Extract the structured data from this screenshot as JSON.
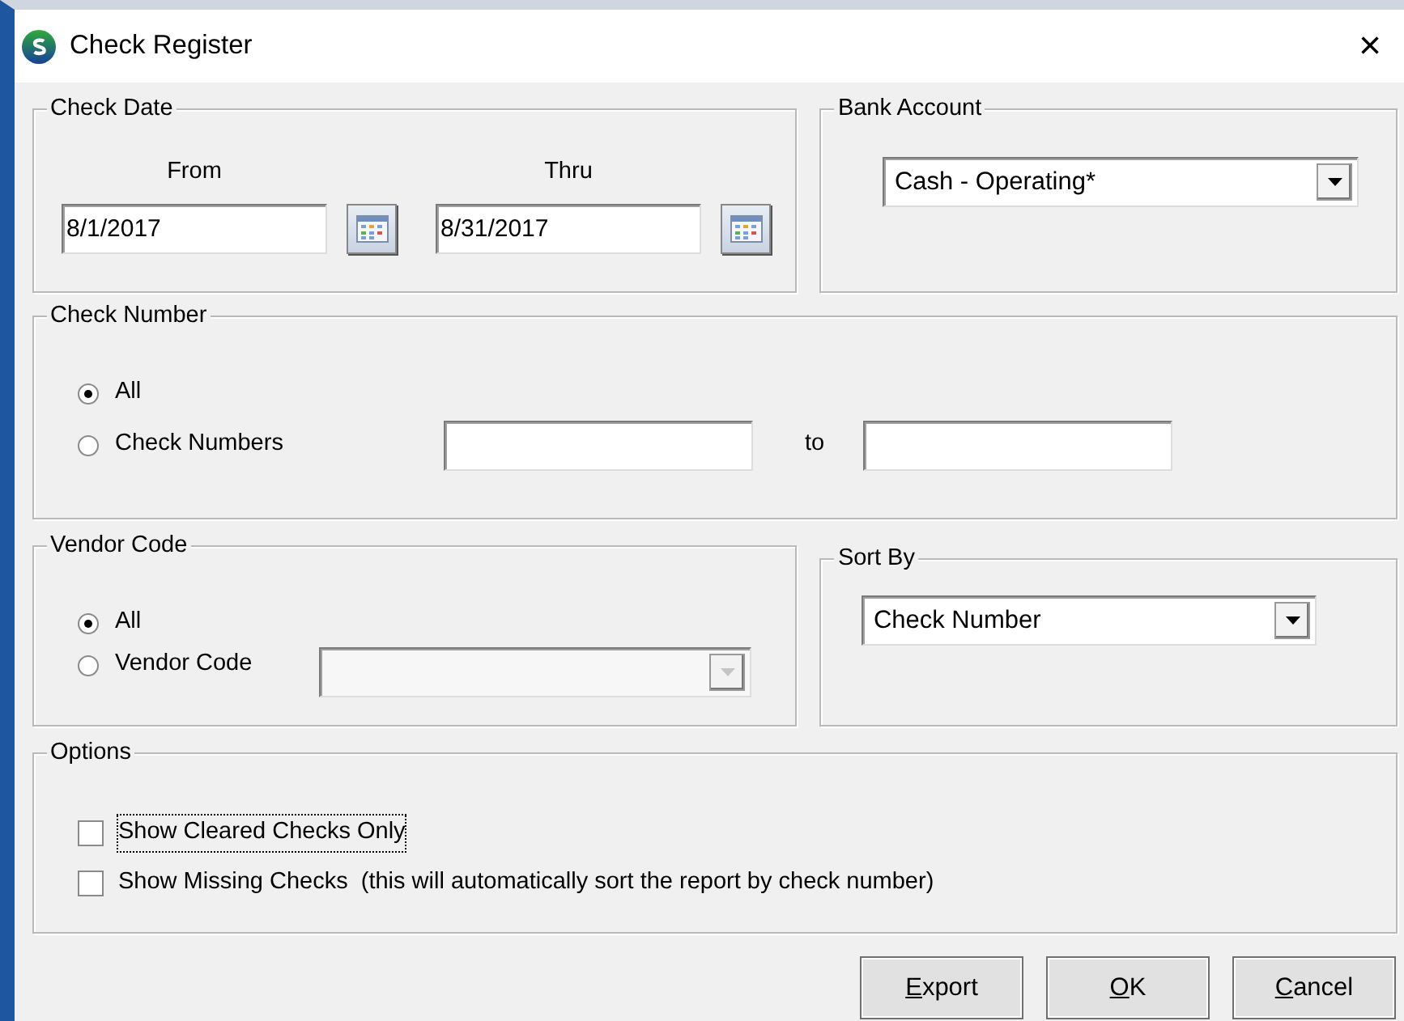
{
  "window": {
    "title": "Check Register",
    "close": "×"
  },
  "check_date": {
    "title": "Check Date",
    "from": {
      "label": "From",
      "value": "8/1/2017"
    },
    "thru": {
      "label": "Thru",
      "value": "8/31/2017"
    }
  },
  "bank_account": {
    "title": "Bank Account",
    "value": "Cash - Operating*"
  },
  "check_number": {
    "title": "Check Number",
    "options": [
      {
        "label": "All",
        "selected": true
      },
      {
        "label": "Check Numbers",
        "selected": false
      }
    ],
    "to_label": "to"
  },
  "vendor_code": {
    "title": "Vendor Code",
    "options": [
      {
        "label": "All",
        "selected": true
      },
      {
        "label": "Vendor Code",
        "selected": false
      }
    ],
    "combo_disabled": true
  },
  "sort_by": {
    "title": "Sort By",
    "value": "Check Number"
  },
  "options": {
    "title": "Options",
    "items": [
      {
        "label": "Show Cleared Checks Only",
        "checked": false,
        "focused": true
      },
      {
        "label": "Show Missing Checks  (this will automatically sort the report by check number)",
        "checked": false,
        "focused": false
      }
    ]
  },
  "buttons": [
    {
      "key": "E",
      "rest": "xport"
    },
    {
      "key": "O",
      "rest": "K"
    },
    {
      "key": "C",
      "rest": "ancel"
    }
  ]
}
